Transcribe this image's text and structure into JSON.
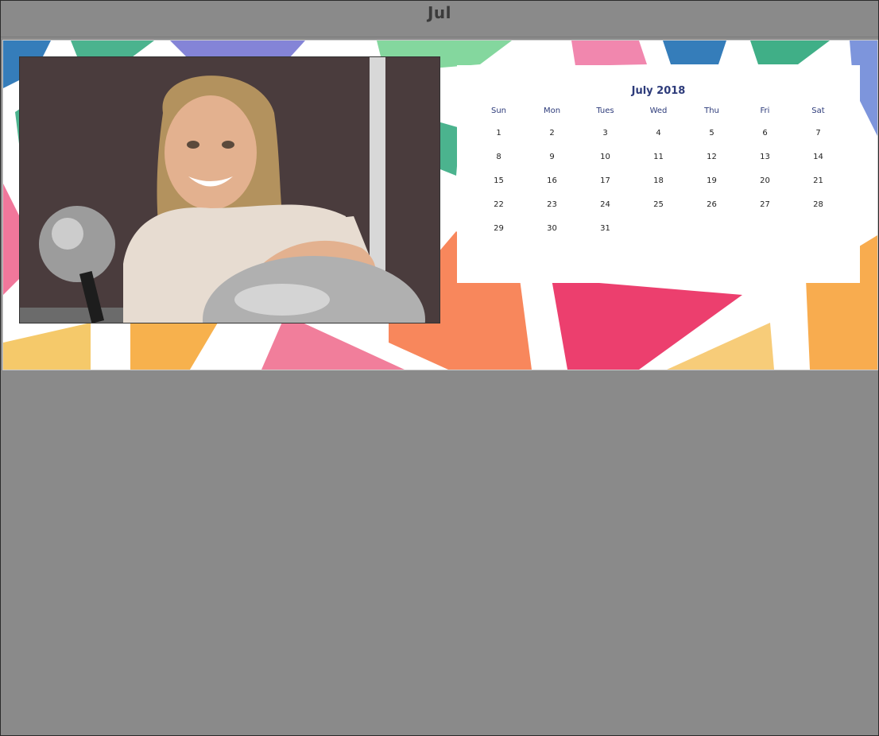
{
  "tab": {
    "title": "Jul"
  },
  "calendar": {
    "title": "July 2018",
    "weekdays": [
      "Sun",
      "Mon",
      "Tues",
      "Wed",
      "Thu",
      "Fri",
      "Sat"
    ],
    "weeks": [
      [
        "1",
        "2",
        "3",
        "4",
        "5",
        "6",
        "7"
      ],
      [
        "8",
        "9",
        "10",
        "11",
        "12",
        "13",
        "14"
      ],
      [
        "15",
        "16",
        "17",
        "18",
        "19",
        "20",
        "21"
      ],
      [
        "22",
        "23",
        "24",
        "25",
        "26",
        "27",
        "28"
      ],
      [
        "29",
        "30",
        "31",
        "",
        "",
        "",
        ""
      ]
    ]
  },
  "colors": {
    "canvas": "#8a8a8a",
    "calendar_accent": "#2d3b7a"
  }
}
